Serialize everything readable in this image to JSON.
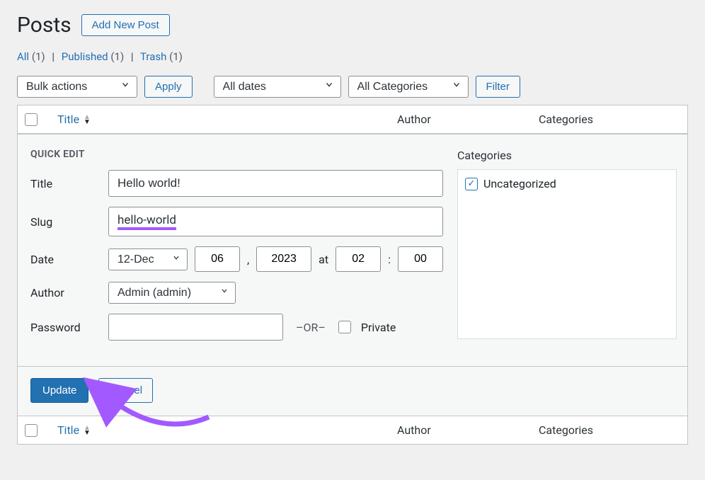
{
  "header": {
    "page_title": "Posts",
    "add_label": "Add New Post"
  },
  "subsubsub": {
    "all_label": "All",
    "all_count": "(1)",
    "published_label": "Published",
    "published_count": "(1)",
    "trash_label": "Trash",
    "trash_count": "(1)"
  },
  "toolbar": {
    "bulk_label": "Bulk actions",
    "apply_label": "Apply",
    "dates_label": "All dates",
    "cats_label": "All Categories",
    "filter_label": "Filter"
  },
  "table": {
    "col_title": "Title",
    "col_author": "Author",
    "col_categories": "Categories"
  },
  "quick_edit": {
    "heading": "QUICK EDIT",
    "title_label": "Title",
    "title_value": "Hello world!",
    "slug_label": "Slug",
    "slug_value": "hello-world",
    "date_label": "Date",
    "month_value": "12-Dec",
    "day_value": "06",
    "year_value": "2023",
    "at_label": "at",
    "hour_value": "02",
    "minute_value": "00",
    "author_label": "Author",
    "author_value": "Admin (admin)",
    "password_label": "Password",
    "password_value": "",
    "or_label": "–OR–",
    "private_label": "Private",
    "cats_heading": "Categories",
    "uncat_label": "Uncategorized",
    "update_label": "Update",
    "cancel_label": "Cancel"
  }
}
